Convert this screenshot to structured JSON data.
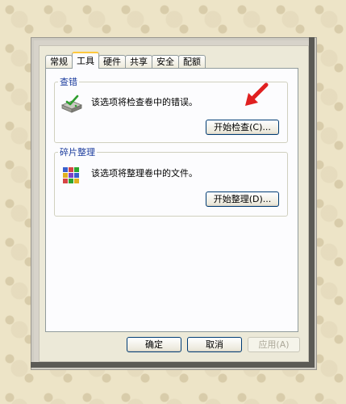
{
  "tabs": [
    "常规",
    "工具",
    "硬件",
    "共享",
    "安全",
    "配额"
  ],
  "active_tab": "工具",
  "error_check": {
    "title": "查错",
    "description": "该选项将检查卷中的错误。",
    "button": "开始检查(C)..."
  },
  "defrag": {
    "title": "碎片整理",
    "description": "该选项将整理卷中的文件。",
    "button": "开始整理(D)..."
  },
  "footer": {
    "ok": "确定",
    "cancel": "取消",
    "apply": "应用(A)"
  },
  "colors": {
    "accent_arrow": "#e02020",
    "legend_text": "#1e3e9e",
    "button_border": "#003c74",
    "active_tab_highlight": "#ffc83c"
  },
  "icons": {
    "error_check": "disk-check-icon",
    "defrag": "defrag-icon",
    "annotation": "red-arrow-icon"
  }
}
